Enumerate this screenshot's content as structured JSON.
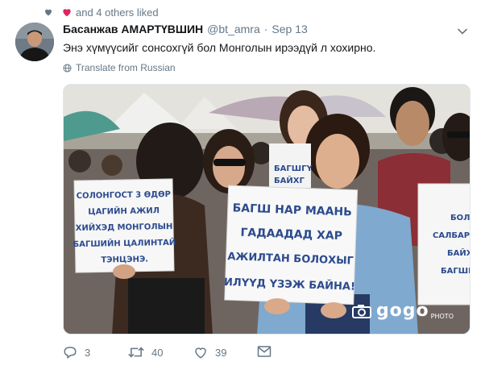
{
  "social_context": {
    "text": "and 4 others liked"
  },
  "tweet": {
    "display_name": "Басанжав АМАРТҮВШИН",
    "handle": "@bt_amra",
    "separator": "·",
    "date": "Sep 13",
    "text": "Энэ хүмүүсийг сонсохгүй бол Монголын ирээдүй л хохирно.",
    "translate_label": "Translate from Russian"
  },
  "media": {
    "signs": {
      "left": [
        "СОЛОНГОСТ 3 ӨДӨР",
        "ЦАГИЙН АЖИЛ",
        "ХИЙХЭД МОНГОЛЫН",
        "БАГШИЙН ЦАЛИНТАЙ",
        "ТЭНЦЭНЭ."
      ],
      "center": [
        "БАГШ НАР МААНЬ",
        "ГАДААДАД ХАР",
        "АЖИЛТАН БОЛОХЫГ",
        "ИЛҮҮД ҮЗЭЖ БАЙНА!"
      ],
      "back": [
        "БАГШГҮ",
        "БАЙХГ"
      ],
      "right": [
        "БОЛ",
        "САЛБАР",
        "БАЙХ",
        "БАГШИ"
      ]
    },
    "watermark": {
      "main": "gogo",
      "sub": "PHOTO"
    }
  },
  "actions": {
    "reply_count": "3",
    "retweet_count": "40",
    "like_count": "39"
  },
  "colors": {
    "like_pink": "#e0245e",
    "gray": "#657786",
    "link": "#1da1f2"
  },
  "icons": [
    "heart-icon",
    "chevron-down-icon",
    "globe-icon",
    "reply-icon",
    "retweet-icon",
    "like-icon",
    "message-icon",
    "camera-icon"
  ]
}
